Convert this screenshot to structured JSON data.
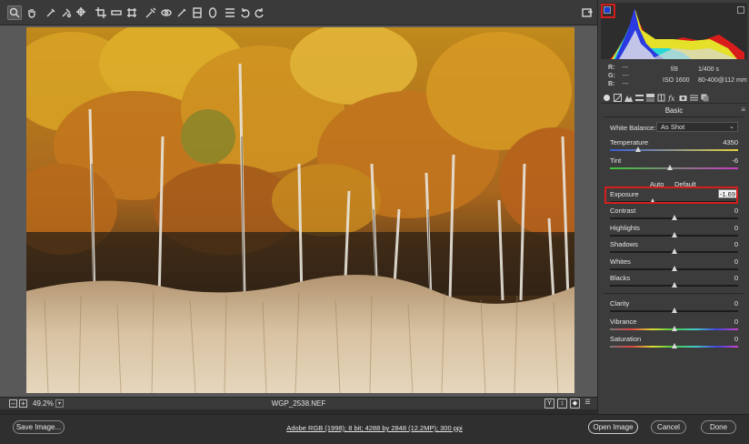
{
  "toolbar": {
    "tools": [
      "zoom-tool",
      "hand-tool",
      "white-balance-tool",
      "color-sampler-tool",
      "targeted-adjustment-tool",
      "crop-tool",
      "straighten-tool",
      "transform-tool",
      "spot-removal-tool",
      "red-eye-tool",
      "adjustment-brush-tool",
      "graduated-filter-tool",
      "radial-filter-tool",
      "preferences",
      "rotate-left",
      "rotate-right"
    ],
    "active_tool": "zoom-tool",
    "fullscreen_icon": "toggle-fullscreen-icon"
  },
  "status": {
    "zoom": "49.2%",
    "filename": "WGP_2538.NEF",
    "zoom_minus": "–",
    "zoom_plus": "+",
    "view_icons": [
      "Y",
      "↕",
      "◆",
      "☰"
    ]
  },
  "histogram": {
    "shadow_clip_color": "#1a3cd8",
    "highlight_clip_color": "#2d2d2d"
  },
  "readout": {
    "r_label": "R:",
    "g_label": "G:",
    "b_label": "B:",
    "r_value": "---",
    "g_value": "---",
    "b_value": "---",
    "aperture": "f/8",
    "shutter": "1/400 s",
    "iso": "ISO 1600",
    "lens": "80-400@112 mm"
  },
  "panel": {
    "section_title": "Basic",
    "menu_icon": "≡",
    "white_balance_label": "White Balance:",
    "white_balance_value": "As Shot",
    "auto_label": "Auto",
    "default_label": "Default",
    "sliders": {
      "temperature": {
        "label": "Temperature",
        "value": "4350",
        "position": 0.22
      },
      "tint": {
        "label": "Tint",
        "value": "-6",
        "position": 0.47
      },
      "exposure": {
        "label": "Exposure",
        "value": "-1.69",
        "position": 0.33
      },
      "contrast": {
        "label": "Contrast",
        "value": "0",
        "position": 0.5
      },
      "highlights": {
        "label": "Highlights",
        "value": "0",
        "position": 0.5
      },
      "shadows": {
        "label": "Shadows",
        "value": "0",
        "position": 0.5
      },
      "whites": {
        "label": "Whites",
        "value": "0",
        "position": 0.5
      },
      "blacks": {
        "label": "Blacks",
        "value": "0",
        "position": 0.5
      },
      "clarity": {
        "label": "Clarity",
        "value": "0",
        "position": 0.5
      },
      "vibrance": {
        "label": "Vibrance",
        "value": "0",
        "position": 0.5
      },
      "saturation": {
        "label": "Saturation",
        "value": "0",
        "position": 0.5
      }
    }
  },
  "bottom": {
    "save_label": "Save Image...",
    "workflow_link": "Adobe RGB (1998); 8 bit; 4288 by 2848 (12.2MP); 300 ppi",
    "open_label": "Open Image",
    "cancel_label": "Cancel",
    "done_label": "Done"
  },
  "colors": {
    "highlight_box": "#d41e1e",
    "panel_bg": "#3c3c3c",
    "canvas_bg": "#595959"
  }
}
